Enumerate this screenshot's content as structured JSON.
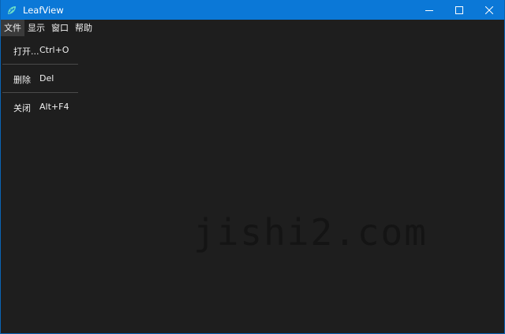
{
  "window": {
    "title": "LeafView",
    "controls": [
      "minimize",
      "maximize",
      "close"
    ]
  },
  "menubar": {
    "items": [
      {
        "label": "文件",
        "active": true
      },
      {
        "label": "显示",
        "active": false
      },
      {
        "label": "窗口",
        "active": false
      },
      {
        "label": "帮助",
        "active": false
      }
    ]
  },
  "dropdown": {
    "items": [
      {
        "label": "打开...",
        "shortcut": "Ctrl+O"
      },
      {
        "label": "删除",
        "shortcut": "Del"
      },
      {
        "label": "关闭",
        "shortcut": "Alt+F4"
      }
    ]
  },
  "watermark": {
    "text": "jishi2.com"
  },
  "colors": {
    "titlebar": "#0b78d7",
    "background": "#1e1e1e",
    "menu_active": "#3a3a3a",
    "text": "#f0f0f0"
  },
  "icons": {
    "app": "leaf-icon",
    "minimize": "minimize-icon",
    "maximize": "maximize-icon",
    "close": "close-icon"
  }
}
